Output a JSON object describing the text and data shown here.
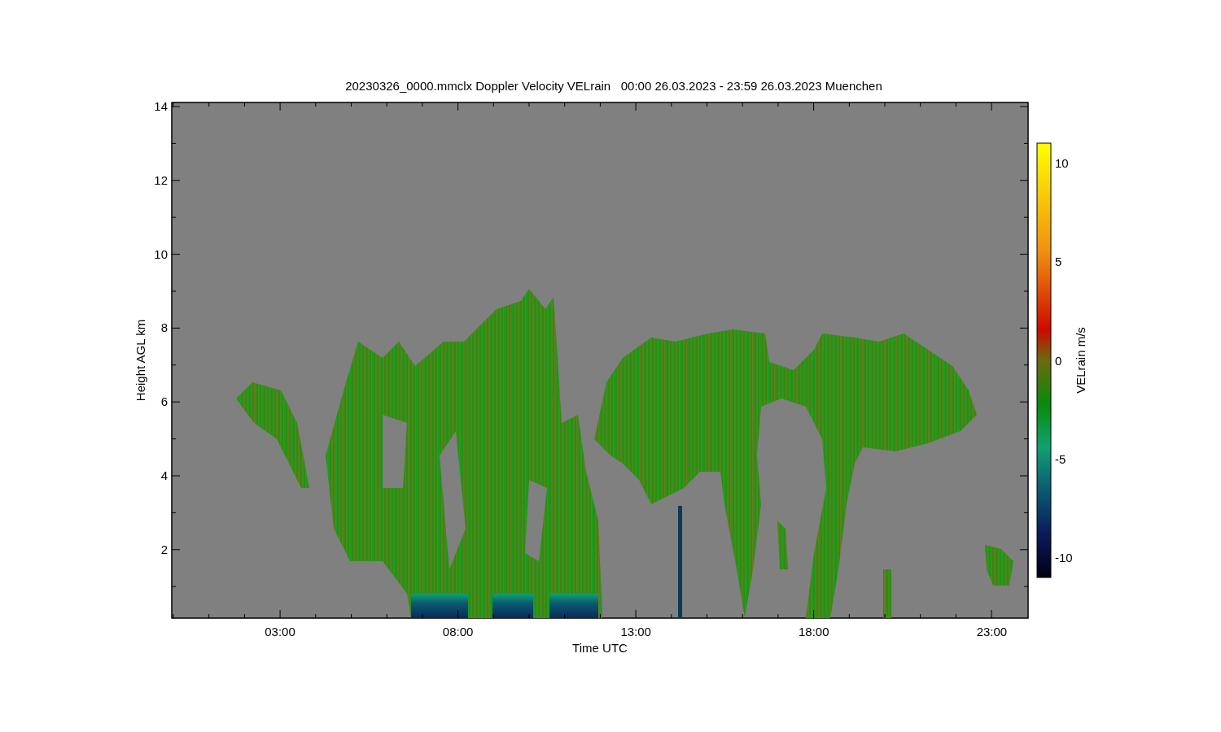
{
  "title": "20230326_0000.mmclx Doppler Velocity VELrain   00:00 26.03.2023 - 23:59 26.03.2023 Muenchen",
  "y_axis": {
    "label": "Height AGL km",
    "ticks": [
      "14",
      "12",
      "10",
      "8",
      "6",
      "4",
      "2"
    ]
  },
  "x_axis": {
    "label": "Time UTC",
    "ticks": [
      "03:00",
      "08:00",
      "13:00",
      "18:00",
      "23:00"
    ]
  },
  "colorbar": {
    "label": "VELrain m/s",
    "ticks": [
      "10",
      "5",
      "0",
      "-5",
      "-10"
    ]
  }
}
